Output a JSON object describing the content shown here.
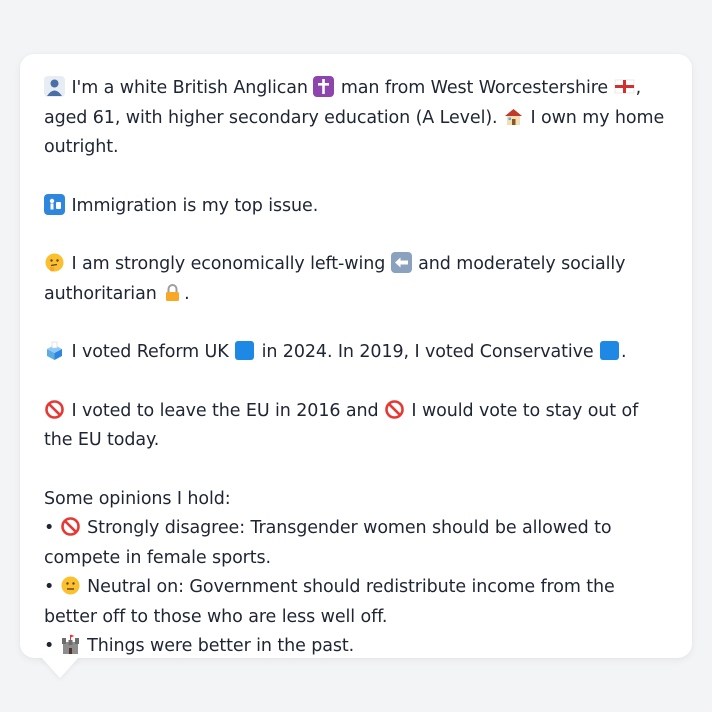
{
  "profile": {
    "p1": {
      "emoji": "bust-in-silhouette-icon",
      "t1": "I'm a white British Anglican",
      "emoji2": "latin-cross-icon",
      "t2": "man from West Worcestershire",
      "emoji3": "england-flag-icon",
      "t3": ", aged 61, with higher secondary education (A Level).",
      "emoji4": "house-icon",
      "t4": "I own my home outright."
    },
    "p2": {
      "emoji": "passport-control-icon",
      "t1": "Immigration is my top issue."
    },
    "p3": {
      "emoji": "thinking-face-icon",
      "t1": "I am strongly economically left-wing",
      "emoji2": "left-arrow-icon",
      "t2": "and moderately socially authoritarian",
      "emoji3": "lock-icon",
      "t3": "."
    },
    "p4": {
      "emoji": "ballot-box-icon",
      "t1": "I voted Reform UK",
      "emoji2": "blue-square-icon",
      "t2": "in 2024. In 2019, I voted Conservative",
      "emoji3": "blue-square-icon",
      "t3": "."
    },
    "p5": {
      "emoji": "prohibited-icon",
      "t1": "I voted to leave the EU in 2016 and",
      "emoji2": "prohibited-icon",
      "t2": "I would vote to stay out of the EU today."
    },
    "opinions": {
      "heading": "Some opinions I hold:",
      "bullet": "•",
      "items": [
        {
          "emoji": "prohibited-icon",
          "text": "Strongly disagree: Transgender women should be allowed to compete in female sports."
        },
        {
          "emoji": "neutral-face-icon",
          "text": "Neutral on: Government should redistribute income from the better off to those who are less well off."
        },
        {
          "emoji": "castle-icon",
          "text": "Things were better in the past."
        }
      ]
    }
  },
  "colors": {
    "background": "#f3f4f6",
    "bubble": "#ffffff",
    "text": "#1f2533",
    "blue_square": "#1e88e5",
    "prohibited": "#e53935"
  }
}
